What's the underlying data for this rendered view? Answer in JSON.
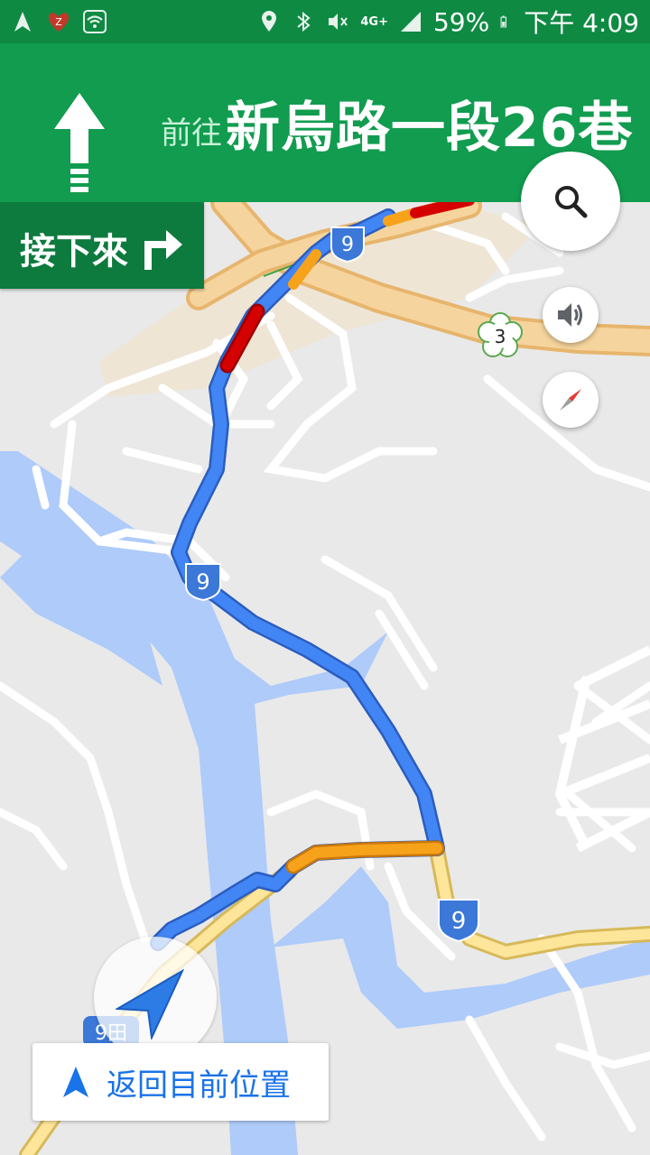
{
  "status_bar": {
    "battery": "59%",
    "time": "下午 4:09",
    "network": "4G+"
  },
  "navigation": {
    "toward_label": "前往",
    "street_name": "新烏路一段26巷",
    "next_label": "接下來"
  },
  "map": {
    "route_shields": [
      "9",
      "9",
      "9"
    ],
    "park_marker": "3",
    "partial_marker": "9田"
  },
  "recenter": {
    "label": "返回目前位置"
  },
  "colors": {
    "header": "#119c4f",
    "next_box": "#0d7a3e",
    "route": "#4285f4",
    "traffic_slow": "#f7a21b",
    "traffic_jam": "#d50000",
    "water": "#aecbfa"
  },
  "icons": {
    "maneuver": "straight-arrow-icon",
    "next_maneuver": "turn-right-icon",
    "search": "search-icon",
    "volume": "volume-icon",
    "compass": "compass-icon",
    "location": "navigation-arrow-icon"
  }
}
